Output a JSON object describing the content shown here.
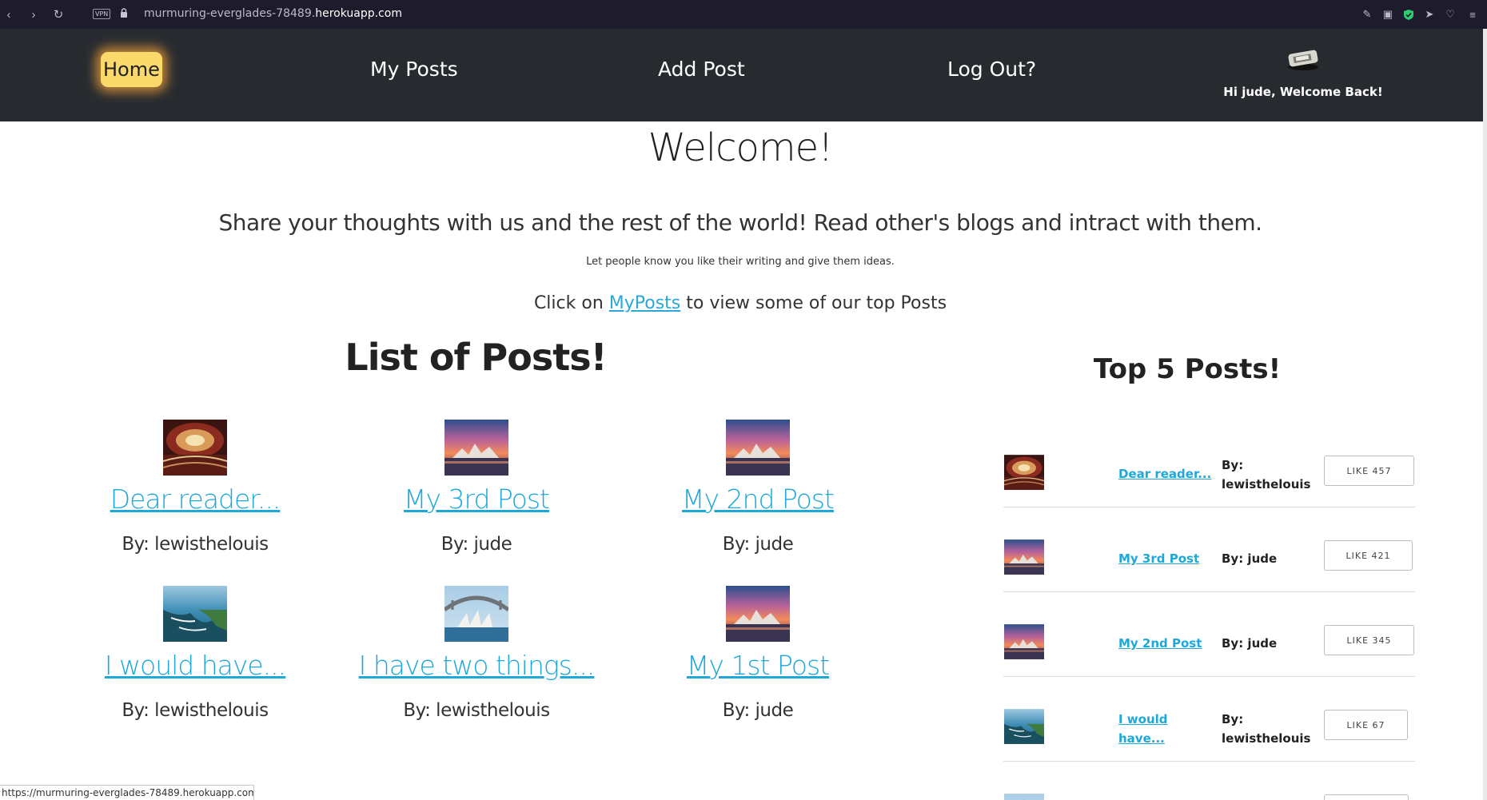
{
  "browser": {
    "vpn_label": "VPN",
    "url_prefix": "murmuring-everglades-78489.",
    "url_domain": "herokuapp.com"
  },
  "nav": {
    "home": "Home",
    "my_posts": "My Posts",
    "add_post": "Add Post",
    "logout": "Log Out?",
    "greeting": "Hi jude, Welcome Back!"
  },
  "hero": {
    "title": "Welcome!",
    "lead": "Share your thoughts with us and the rest of the world! Read other's blogs and intract with them.",
    "note": "Let people know you like their writing and give them ideas.",
    "click_prefix": "Click on ",
    "click_link": "MyPosts",
    "click_suffix": " to view some of our top Posts"
  },
  "list": {
    "title": "List of Posts!",
    "posts": [
      {
        "title": "Dear reader...",
        "author": "By: lewisthelouis",
        "thumb": "theater"
      },
      {
        "title": "My 3rd Post",
        "author": "By: jude",
        "thumb": "sunset"
      },
      {
        "title": "My 2nd Post",
        "author": "By: jude",
        "thumb": "sunset"
      },
      {
        "title": "I would have...",
        "author": "By: lewisthelouis",
        "thumb": "coast"
      },
      {
        "title": "I have two things...",
        "author": "By: lewisthelouis",
        "thumb": "opera"
      },
      {
        "title": "My 1st Post",
        "author": "By: jude",
        "thumb": "sunset"
      }
    ]
  },
  "top": {
    "title": "Top 5 Posts!",
    "rows": [
      {
        "title_l1": "Dear reader...",
        "title_l2": "",
        "by_l1": "By:",
        "by_l2": "lewisthelouis",
        "like": "LIKE 457"
      },
      {
        "title_l1": "My 3rd Post",
        "title_l2": "",
        "by_l1": "By: jude",
        "by_l2": "",
        "like": "LIKE 421"
      },
      {
        "title_l1": "My 2nd Post",
        "title_l2": "",
        "by_l1": "By: jude",
        "by_l2": "",
        "like": "LIKE 345"
      },
      {
        "title_l1": "I would",
        "title_l2": "have...",
        "by_l1": "By:",
        "by_l2": "lewisthelouis",
        "like": "LIKE 67"
      }
    ]
  },
  "status_url": "https://murmuring-everglades-78489.herokuapp.com"
}
